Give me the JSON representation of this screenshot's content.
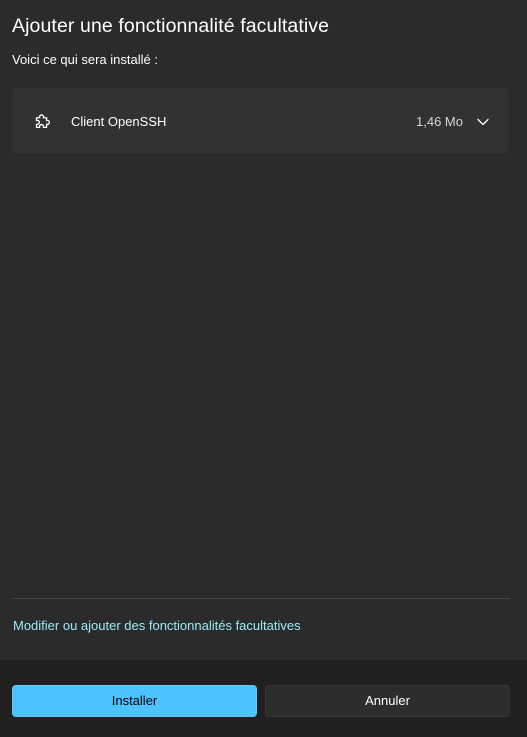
{
  "dialog": {
    "title": "Ajouter une fonctionnalité facultative",
    "subtitle": "Voici ce qui sera installé :"
  },
  "feature": {
    "icon": "puzzle-piece-icon",
    "name": "Client OpenSSH",
    "size": "1,46 Mo",
    "expand_icon": "chevron-down-icon"
  },
  "links": {
    "modify": "Modifier ou ajouter des fonctionnalités facultatives"
  },
  "buttons": {
    "install": "Installer",
    "cancel": "Annuler"
  },
  "colors": {
    "accent": "#4cc2ff",
    "link": "#99ebff",
    "background": "#2b2b2b",
    "footer": "#202020"
  }
}
